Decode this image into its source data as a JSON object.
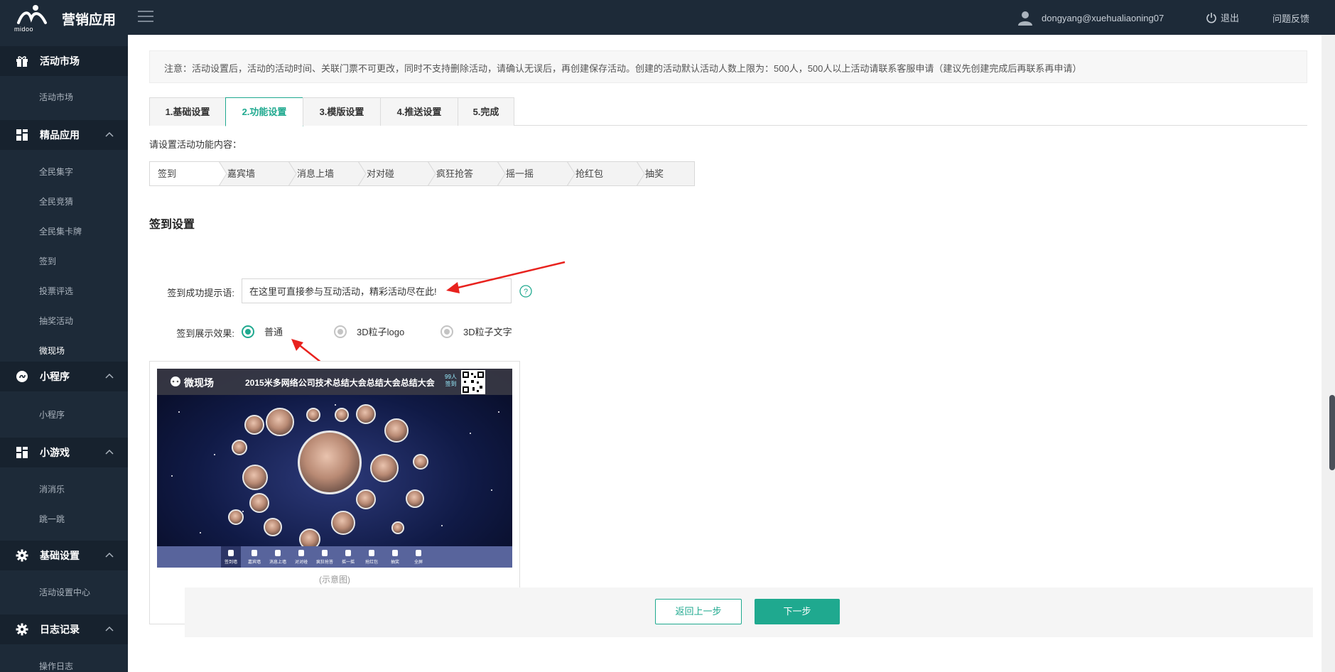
{
  "header": {
    "logo_text": "midoo",
    "app_title": "营销应用",
    "user": "dongyang@xuehualiaoning07",
    "logout": "退出",
    "feedback": "问题反馈"
  },
  "sidebar": {
    "groups": [
      {
        "label": "活动市场",
        "icon": "grid-icon",
        "items": [
          "活动市场"
        ]
      },
      {
        "label": "精品应用",
        "icon": "grid-icon",
        "items": [
          "全民集字",
          "全民竞猜",
          "全民集卡牌",
          "签到",
          "投票评选",
          "抽奖活动",
          "微现场"
        ]
      },
      {
        "label": "小程序",
        "icon": "mini-program-icon",
        "items": [
          "小程序"
        ]
      },
      {
        "label": "小游戏",
        "icon": "grid-icon",
        "items": [
          "消消乐",
          "跳一跳"
        ]
      },
      {
        "label": "基础设置",
        "icon": "gear-icon",
        "items": [
          "活动设置中心"
        ]
      },
      {
        "label": "日志记录",
        "icon": "gear-icon",
        "items": [
          "操作日志"
        ]
      }
    ],
    "active_item": "微现场"
  },
  "notice": "注意：活动设置后，活动的活动时间、关联门票不可更改，同时不支持删除活动，请确认无误后，再创建保存活动。创建的活动默认活动人数上限为：500人，500人以上活动请联系客服申请（建议先创建完成后再联系再申请）",
  "tabs": [
    "1.基础设置",
    "2.功能设置",
    "3.模版设置",
    "4.推送设置",
    "5.完成"
  ],
  "active_tab": "2.功能设置",
  "function_prompt": "请设置活动功能内容：",
  "function_steps": [
    "签到",
    "嘉宾墙",
    "消息上墙",
    "对对碰",
    "疯狂抢答",
    "摇一摇",
    "抢红包",
    "抽奖"
  ],
  "section_title": "签到设置",
  "form": {
    "tip_label": "签到成功提示语:",
    "tip_value": "在这里可直接参与互动活动，精彩活动尽在此!",
    "effect_label": "签到展示效果:",
    "effect_options": [
      "普通",
      "3D粒子logo",
      "3D粒子文字"
    ],
    "effect_selected": "普通"
  },
  "preview": {
    "brand": "微现场",
    "title": "2015米多网络公司技术总结大会总结大会总结大会",
    "count": "99人",
    "count_sub": "签到",
    "footer_items": [
      "签到墙",
      "嘉宾墙",
      "消息上墙",
      "对对碰",
      "疯狂抢答",
      "摇一摇",
      "抢红包",
      "抽奖",
      "全屏"
    ],
    "caption": "(示意图)"
  },
  "buttons": {
    "back": "返回上一步",
    "next": "下一步"
  },
  "colors": {
    "accent": "#1fa98f",
    "nav_bg": "#1d2a38",
    "annotation": "#e8221e"
  }
}
